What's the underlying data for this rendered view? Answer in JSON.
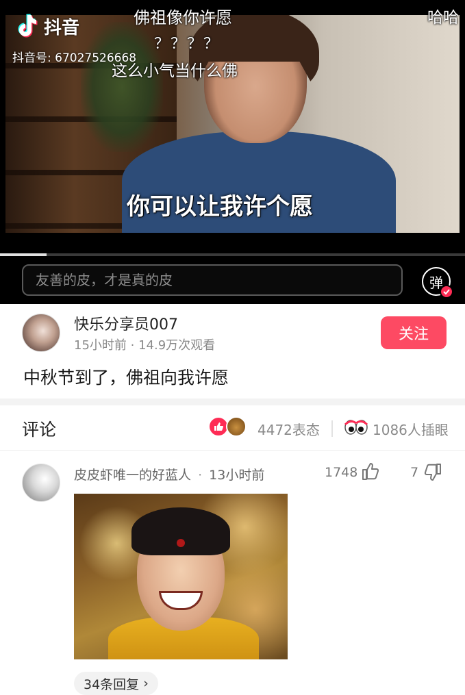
{
  "app": {
    "logo_text": "抖音",
    "douyin_id": "抖音号: 67027526668"
  },
  "video": {
    "captions": {
      "wish": "佛祖像你许愿",
      "questions": "？？？？",
      "stingy": "这么小气当什么佛",
      "haha": "哈哈",
      "main": "你可以让我许个愿"
    },
    "progress_percent": 10
  },
  "danmaku": {
    "placeholder": "友善的皮，才是真的皮",
    "toggle_label": "弹"
  },
  "author": {
    "name": "快乐分享员007",
    "meta": "15小时前 · 14.9万次观看",
    "follow_label": "关注",
    "description": "中秋节到了，佛祖向我许愿"
  },
  "comments_header": {
    "title": "评论",
    "reactions_count": "4472表态",
    "eyes_count": "1086人插眼"
  },
  "comment": {
    "username": "皮皮虾唯一的好蓝人",
    "time": "13小时前",
    "dot": "·",
    "likes": "1748",
    "dislikes": "7",
    "replies_label": "34条回复",
    "replies_chevron": "›"
  },
  "colors": {
    "accent": "#fe2c55",
    "follow_button": "#fd4a63"
  }
}
